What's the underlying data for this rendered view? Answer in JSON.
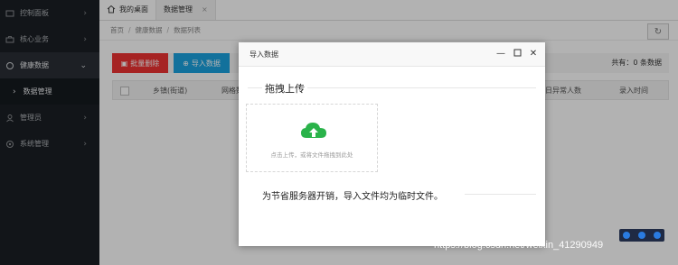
{
  "sidebar": {
    "items": [
      {
        "label": "控制面板",
        "icon": "dashboard-icon"
      },
      {
        "label": "核心业务",
        "icon": "briefcase-icon"
      },
      {
        "label": "健康数据",
        "icon": "health-icon"
      },
      {
        "label": "数据管理",
        "icon": "chevron-right-icon"
      },
      {
        "label": "管理员",
        "icon": "user-icon"
      },
      {
        "label": "系统管理",
        "icon": "gear-icon"
      }
    ]
  },
  "tabs": [
    {
      "label": "我的桌面",
      "icon": "home-icon"
    },
    {
      "label": "数据管理",
      "close": "×"
    }
  ],
  "breadcrumb": [
    "首页",
    "健康数据",
    "数据列表"
  ],
  "toolbar": {
    "batch_delete": "批量删除",
    "import": "导入数据",
    "total": "共有：0 条数据"
  },
  "table": {
    "headers": [
      "乡镇(街道)",
      "网格数",
      "本日异常人数",
      "录入时间"
    ]
  },
  "modal": {
    "title": "导入数据",
    "section_title": "拖拽上传",
    "drop_text": "点击上传，或将文件拖拽到此处",
    "note": "为节省服务器开销，导入文件均为临时文件。"
  },
  "watermark": "https://blog.csdn.net/weixin_41290949",
  "colors": {
    "sidebar_bg": "#1b1f24",
    "danger": "#e33333",
    "primary": "#1aa3e0",
    "upload_green": "#2ab34a"
  }
}
